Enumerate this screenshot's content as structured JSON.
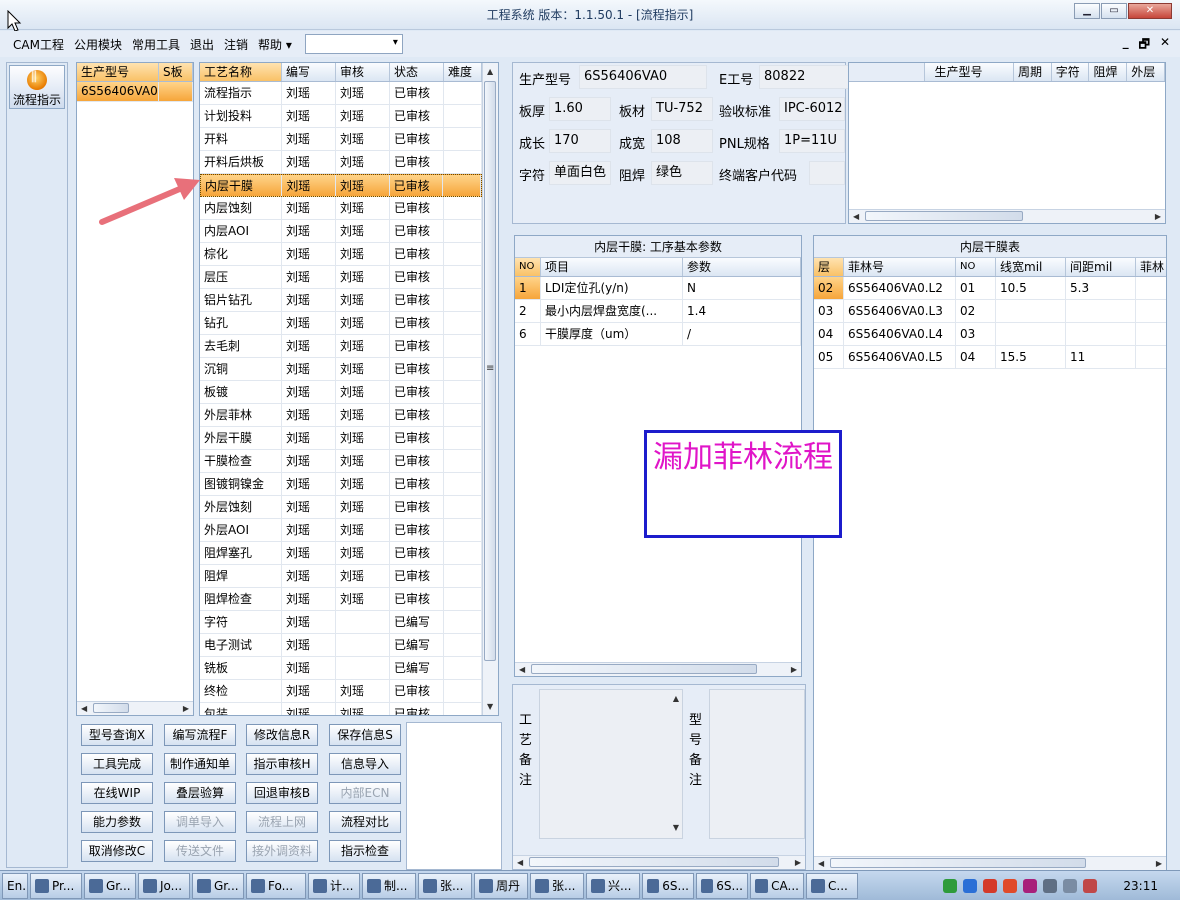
{
  "window": {
    "title": "工程系统   版本：1.1.50.1 - [流程指示]"
  },
  "menu": {
    "items": [
      "CAM工程",
      "公用模块",
      "常用工具",
      "退出",
      "注销",
      "帮助 ▾"
    ],
    "mdi": [
      "_",
      "🗗",
      "✕"
    ]
  },
  "leftnav": {
    "button_label": "流程指示"
  },
  "product_list": {
    "headers": [
      "生产型号",
      "S板"
    ],
    "rows": [
      [
        "6S56406VA0",
        ""
      ]
    ]
  },
  "process_grid": {
    "headers": [
      "工艺名称",
      "编写",
      "审核",
      "状态",
      "难度"
    ],
    "rows": [
      [
        "流程指示",
        "刘瑶",
        "刘瑶",
        "已审核",
        ""
      ],
      [
        "计划投料",
        "刘瑶",
        "刘瑶",
        "已审核",
        ""
      ],
      [
        "开料",
        "刘瑶",
        "刘瑶",
        "已审核",
        ""
      ],
      [
        "开料后烘板",
        "刘瑶",
        "刘瑶",
        "已审核",
        ""
      ],
      [
        "内层干膜",
        "刘瑶",
        "刘瑶",
        "已审核",
        ""
      ],
      [
        "内层蚀刻",
        "刘瑶",
        "刘瑶",
        "已审核",
        ""
      ],
      [
        "内层AOI",
        "刘瑶",
        "刘瑶",
        "已审核",
        ""
      ],
      [
        "棕化",
        "刘瑶",
        "刘瑶",
        "已审核",
        ""
      ],
      [
        "层压",
        "刘瑶",
        "刘瑶",
        "已审核",
        ""
      ],
      [
        "铝片钻孔",
        "刘瑶",
        "刘瑶",
        "已审核",
        ""
      ],
      [
        "钻孔",
        "刘瑶",
        "刘瑶",
        "已审核",
        ""
      ],
      [
        "去毛刺",
        "刘瑶",
        "刘瑶",
        "已审核",
        ""
      ],
      [
        "沉铜",
        "刘瑶",
        "刘瑶",
        "已审核",
        ""
      ],
      [
        "板镀",
        "刘瑶",
        "刘瑶",
        "已审核",
        ""
      ],
      [
        "外层菲林",
        "刘瑶",
        "刘瑶",
        "已审核",
        ""
      ],
      [
        "外层干膜",
        "刘瑶",
        "刘瑶",
        "已审核",
        ""
      ],
      [
        "干膜检查",
        "刘瑶",
        "刘瑶",
        "已审核",
        ""
      ],
      [
        "图镀铜镍金",
        "刘瑶",
        "刘瑶",
        "已审核",
        ""
      ],
      [
        "外层蚀刻",
        "刘瑶",
        "刘瑶",
        "已审核",
        ""
      ],
      [
        "外层AOI",
        "刘瑶",
        "刘瑶",
        "已审核",
        ""
      ],
      [
        "阻焊塞孔",
        "刘瑶",
        "刘瑶",
        "已审核",
        ""
      ],
      [
        "阻焊",
        "刘瑶",
        "刘瑶",
        "已审核",
        ""
      ],
      [
        "阻焊检查",
        "刘瑶",
        "刘瑶",
        "已审核",
        ""
      ],
      [
        "字符",
        "刘瑶",
        "",
        "已编写",
        ""
      ],
      [
        "电子测试",
        "刘瑶",
        "",
        "已编写",
        ""
      ],
      [
        "铣板",
        "刘瑶",
        "",
        "已编写",
        ""
      ],
      [
        "终检",
        "刘瑶",
        "刘瑶",
        "已审核",
        ""
      ],
      [
        "包装",
        "刘瑶",
        "刘瑶",
        "已审核",
        ""
      ]
    ],
    "selected_index": 4
  },
  "buttons": [
    [
      "型号查询X",
      "编写流程F",
      "修改信息R",
      "保存信息S"
    ],
    [
      "工具完成",
      "制作通知单",
      "指示审核H",
      "信息导入"
    ],
    [
      "在线WIP",
      "叠层验算",
      "回退审核B",
      "内部ECN"
    ],
    [
      "能力参数",
      "调单导入",
      "流程上网",
      "流程对比"
    ],
    [
      "取消修改C",
      "传送文件",
      "接外调资料",
      "指示检查"
    ]
  ],
  "disabled_buttons": [
    "内部ECN",
    "调单导入",
    "流程上网",
    "传送文件",
    "接外调资料"
  ],
  "info": {
    "model_label": "生产型号",
    "model_value": "6S56406VA0",
    "eno_label": "E工号",
    "eno_value": "80822",
    "thickness_label": "板厚",
    "thickness_value": "1.60",
    "material_label": "板材",
    "material_value": "TU-752",
    "standard_label": "验收标准",
    "standard_value": "IPC-6012",
    "length_label": "成长",
    "length_value": "170",
    "width_label": "成宽",
    "width_value": "108",
    "pnl_label": "PNL规格",
    "pnl_value": "1P=11U",
    "char_label": "字符",
    "char_value": "单面白色",
    "mask_label": "阻焊",
    "mask_value": "绿色",
    "client_label": "终端客户代码",
    "client_value": ""
  },
  "mini_grid": {
    "headers": [
      "",
      "生产型号",
      "周期",
      "字符",
      "阻焊",
      "外层"
    ]
  },
  "params": {
    "title": "内层干膜: 工序基本参数",
    "headers": [
      "NO",
      "项目",
      "参数"
    ],
    "rows": [
      [
        "1",
        "LDI定位孔(y/n)",
        "N"
      ],
      [
        "2",
        "最小内层焊盘宽度(...",
        "1.4"
      ],
      [
        "6",
        "干膜厚度（um）",
        "/"
      ]
    ]
  },
  "film_table": {
    "title": "内层干膜表",
    "headers": [
      "层",
      "菲林号",
      "NO",
      "线宽mil",
      "间距mil",
      "菲林"
    ],
    "rows": [
      [
        "02",
        "6S56406VA0.L2",
        "01",
        "10.5",
        "5.3",
        ""
      ],
      [
        "03",
        "6S56406VA0.L3",
        "02",
        "",
        "",
        ""
      ],
      [
        "04",
        "6S56406VA0.L4",
        "03",
        "",
        "",
        ""
      ],
      [
        "05",
        "6S56406VA0.L5",
        "04",
        "15.5",
        "11",
        ""
      ]
    ]
  },
  "notes": {
    "process_label": "工\n艺\n备\n注",
    "model_label": "型\n号\n备\n注"
  },
  "overlay": {
    "text": "漏加菲林流程"
  },
  "taskbar": {
    "tasks": [
      "En...",
      "Pr...",
      "Gr...",
      "Jo...",
      "Gr...",
      "Fo...",
      "计...",
      "制...",
      "张...",
      "周丹",
      "张...",
      "兴...",
      "6S...",
      "6S...",
      "CA...",
      "C..."
    ],
    "clock": "23:11"
  },
  "colors": {
    "selection": "#f6a53a",
    "overlay_text": "#e015c8",
    "overlay_border": "#1c1ccc",
    "arrow": "#e8707a"
  }
}
